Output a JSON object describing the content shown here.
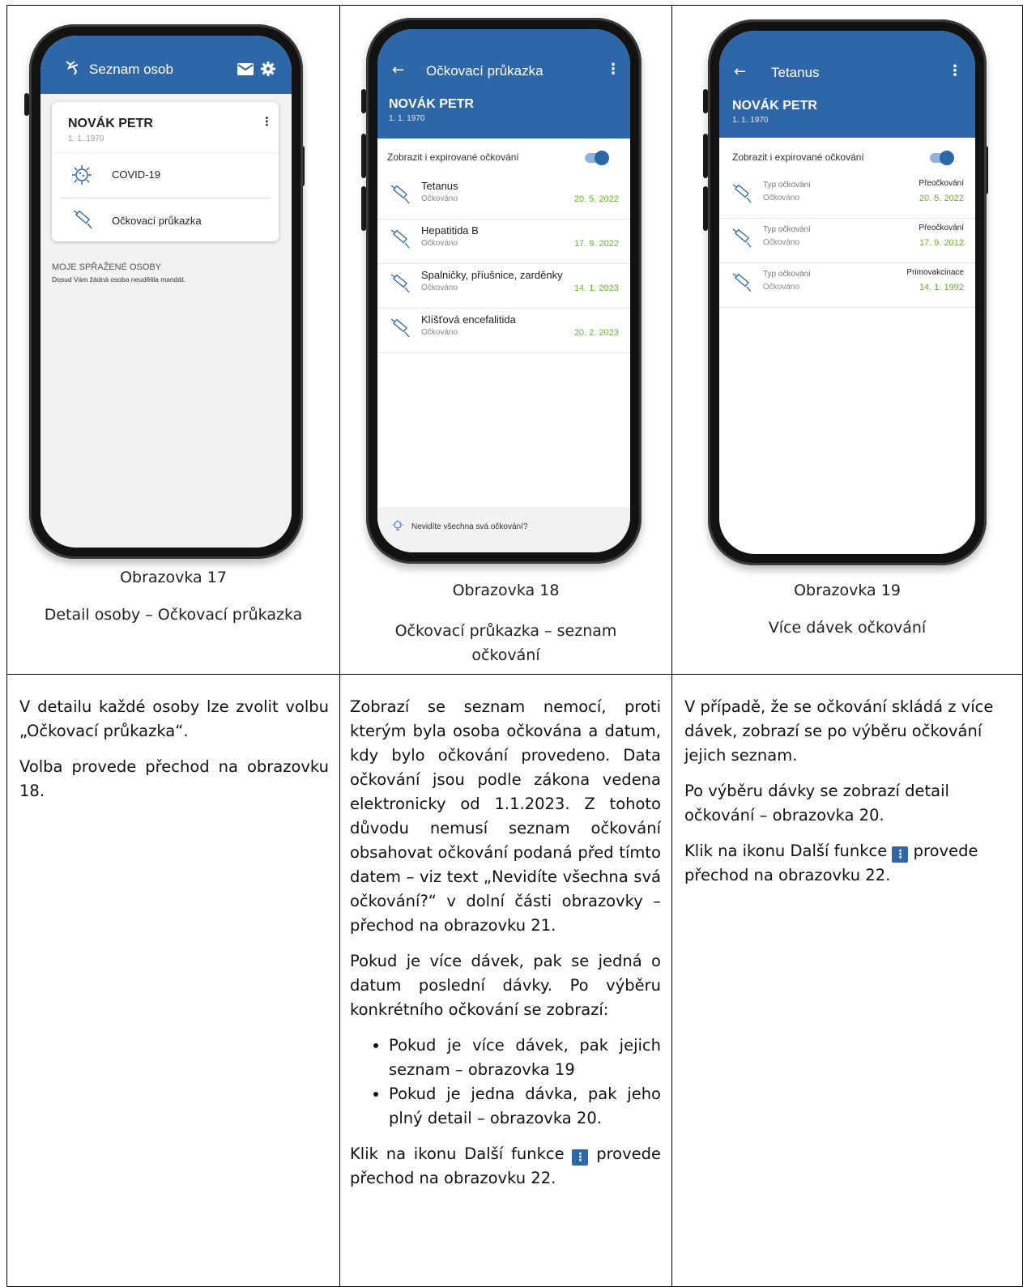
{
  "screen17": {
    "appbar_title": "Seznam osob",
    "person_name": "NOVÁK PETR",
    "person_dob": "1. 1. 1970",
    "menu_covid": "COVID-19",
    "menu_vaccination_card": "Očkovací průkazka",
    "linked_heading": "MOJE SPŘAŽENÉ OSOBY",
    "linked_empty": "Dosud Vám žádná osoba neudělila mandát.",
    "icons": [
      "emblem-icon",
      "mail-icon",
      "gear-icon",
      "kebab-icon",
      "virus-icon",
      "syringe-icon"
    ]
  },
  "screen18": {
    "appbar_title": "Očkovací průkazka",
    "person_name": "NOVÁK PETR",
    "person_dob": "1. 1. 1970",
    "toggle_label": "Zobrazit i expirované očkování",
    "vaccinations": [
      {
        "name": "Tetanus",
        "status": "Očkováno",
        "date": "20. 5. 2022"
      },
      {
        "name": "Hepatitida B",
        "status": "Očkováno",
        "date": "17. 9. 2022"
      },
      {
        "name": "Spalničky, příušnice, zarděnky",
        "status": "Očkováno",
        "date": "14. 1. 2023"
      },
      {
        "name": "Klíšťová encefalitida",
        "status": "Očkováno",
        "date": "20. 2. 2023"
      }
    ],
    "footer_hint": "Nevidíte všechna svá očkování?"
  },
  "screen19": {
    "appbar_title": "Tetanus",
    "person_name": "NOVÁK PETR",
    "person_dob": "1. 1. 1970",
    "toggle_label": "Zobrazit i expirované očkování",
    "doses": [
      {
        "label": "Typ očkování",
        "status": "Očkováno",
        "type": "Přeočkování",
        "date": "20. 5. 2022"
      },
      {
        "label": "Typ očkování",
        "status": "Očkováno",
        "type": "Přeočkování",
        "date": "17. 9. 2012"
      },
      {
        "label": "Typ očkování",
        "status": "Očkováno",
        "type": "Primovakcinace",
        "date": "14. 1. 1992"
      }
    ]
  },
  "captions": {
    "c17_title": "Obrazovka 17",
    "c17_sub": "Detail osoby – Očkovací průkazka",
    "c18_title": "Obrazovka 18",
    "c18_sub": "Očkovací průkazka – seznam očkování",
    "c19_title": "Obrazovka 19",
    "c19_sub": "Více dávek očkování"
  },
  "descriptions": {
    "col1_p1": "V detailu každé osoby lze zvolit volbu „Očkovací průkazka“.",
    "col1_p2": "Volba provede přechod na obrazovku 18.",
    "col2_p1": "Zobrazí se seznam nemocí, proti kterým byla osoba očkována a datum, kdy bylo očkování provedeno. Data očkování jsou podle zákona vedena elektronicky od 1.1.2023. Z tohoto důvodu nemusí seznam očkování obsahovat očkování podaná před tímto datem – viz text „Nevidíte všechna svá očkování?“ v dolní části obrazovky – přechod na obrazovku 21.",
    "col2_p2": "Pokud je více dávek, pak se jedná o datum poslední dávky. Po výběru konkrétního očkování se zobrazí:",
    "col2_bullets": [
      "Pokud je více dávek, pak jejich seznam – obrazovka 19",
      "Pokud je jedna dávka, pak jeho plný detail – obrazovka 20."
    ],
    "col2_p3_before": "Klik na ikonu Další funkce",
    "col2_p3_after": "provede přechod na obrazovku 22.",
    "col3_p1": "V případě, že se očkování skládá z více dávek, zobrazí se po výběru očkování jejich seznam.",
    "col3_p2": "Po výběru dávky se zobrazí detail očkování – obrazovka 20.",
    "col3_p3_before": "Klik na ikonu Další funkce",
    "col3_p3_after": "provede přechod na obrazovku 22."
  }
}
